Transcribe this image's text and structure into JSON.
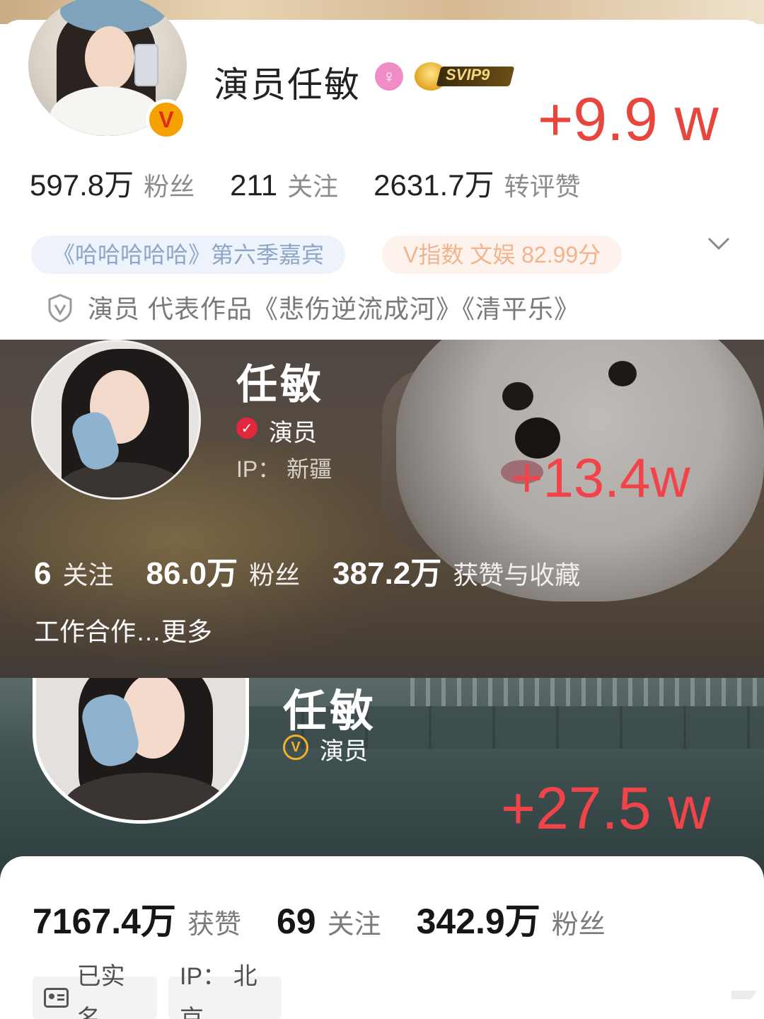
{
  "weibo": {
    "name": "演员任敏",
    "gender_symbol": "♀",
    "vip_label": "SVIP9",
    "verify_badge": "V",
    "gain": "+9.9 w",
    "stats": [
      {
        "value": "597.8万",
        "label": "粉丝"
      },
      {
        "value": "211",
        "label": "关注"
      },
      {
        "value": "2631.7万",
        "label": "转评赞"
      }
    ],
    "tag_guest": "《哈哈哈哈哈》第六季嘉宾",
    "tag_index": "V指数 文娱 82.99分",
    "description": "演员 代表作品《悲伤逆流成河》《清平乐》",
    "colors": {
      "accent": "#e8453c",
      "gender": "#f08cc8",
      "vip_gold": "#f7d77b"
    },
    "icons": {
      "expand": "chevron-down-icon",
      "verified": "shield-v-icon"
    }
  },
  "xiaohongshu": {
    "name": "任敏",
    "verify_mark": "✓",
    "role": "演员",
    "ip": "IP： 新疆",
    "gain": "+13.4w",
    "stats": [
      {
        "value": "6",
        "label": "关注"
      },
      {
        "value": "86.0万",
        "label": "粉丝"
      },
      {
        "value": "387.2万",
        "label": "获赞与收藏"
      }
    ],
    "work": "工作合作…更多",
    "colors": {
      "accent": "#f2434a",
      "verify": "#e2283d"
    }
  },
  "douyin": {
    "name": "任敏",
    "verify_badge": "V",
    "role": "演员",
    "gain": "+27.5 w",
    "stats": [
      {
        "value": "7167.4万",
        "label": "获赞"
      },
      {
        "value": "69",
        "label": "关注"
      },
      {
        "value": "342.9万",
        "label": "粉丝"
      }
    ],
    "tag_realname": "已实名",
    "tag_ip": "IP： 北京",
    "colors": {
      "accent": "#f0434a",
      "badge": "#f2b12a"
    }
  }
}
